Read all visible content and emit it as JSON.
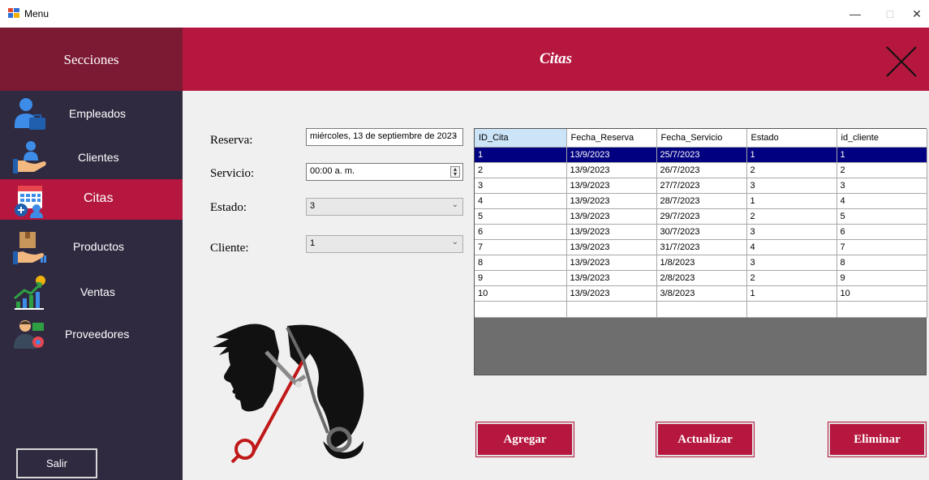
{
  "window": {
    "title": "Menu",
    "controls": {
      "minimize": "—",
      "maximize": "□",
      "close": "✕"
    }
  },
  "sidebar": {
    "header": "Secciones",
    "items": [
      {
        "label": "Empleados",
        "icon": "employees-icon"
      },
      {
        "label": "Clientes",
        "icon": "clients-icon"
      },
      {
        "label": "Citas",
        "icon": "calendar-icon",
        "active": true
      },
      {
        "label": "Productos",
        "icon": "products-icon"
      },
      {
        "label": "Ventas",
        "icon": "sales-chart-icon"
      },
      {
        "label": "Proveedores",
        "icon": "suppliers-icon"
      }
    ],
    "exit_label": "Salir"
  },
  "header": {
    "title": "Citas"
  },
  "form": {
    "reserva": {
      "label": "Reserva:",
      "value": "miércoles, 13 de septiembre de 2023"
    },
    "servicio": {
      "label": "Servicio:",
      "value": "00:00 a. m."
    },
    "estado": {
      "label": "Estado:",
      "value": "3"
    },
    "cliente": {
      "label": "Cliente:",
      "value": "1"
    }
  },
  "table": {
    "columns": [
      "ID_Cita",
      "Fecha_Reserva",
      "Fecha_Servicio",
      "Estado",
      "id_cliente"
    ],
    "rows": [
      [
        "1",
        "13/9/2023",
        "25/7/2023",
        "1",
        "1"
      ],
      [
        "2",
        "13/9/2023",
        "26/7/2023",
        "2",
        "2"
      ],
      [
        "3",
        "13/9/2023",
        "27/7/2023",
        "3",
        "3"
      ],
      [
        "4",
        "13/9/2023",
        "28/7/2023",
        "1",
        "4"
      ],
      [
        "5",
        "13/9/2023",
        "29/7/2023",
        "2",
        "5"
      ],
      [
        "6",
        "13/9/2023",
        "30/7/2023",
        "3",
        "6"
      ],
      [
        "7",
        "13/9/2023",
        "31/7/2023",
        "4",
        "7"
      ],
      [
        "8",
        "13/9/2023",
        "1/8/2023",
        "3",
        "8"
      ],
      [
        "9",
        "13/9/2023",
        "2/8/2023",
        "2",
        "9"
      ],
      [
        "10",
        "13/9/2023",
        "3/8/2023",
        "1",
        "10"
      ]
    ],
    "selected_row": 0
  },
  "actions": {
    "add": "Agregar",
    "update": "Actualizar",
    "delete": "Eliminar"
  },
  "colors": {
    "brand": "#b5173e",
    "brand_dark": "#7c1a34",
    "sidebar": "#2f2a40",
    "selection": "#000080"
  }
}
